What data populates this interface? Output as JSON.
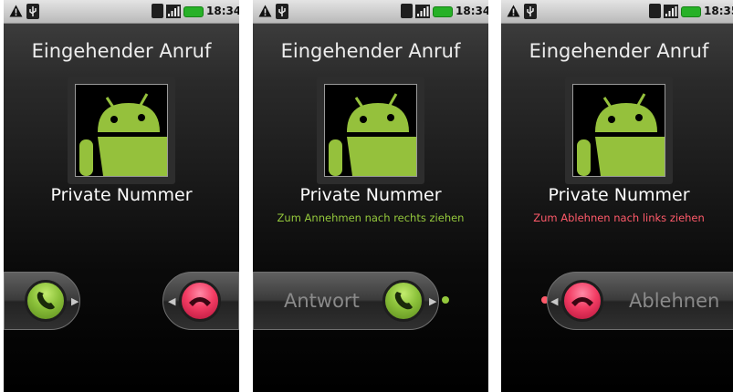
{
  "colors": {
    "status_bar": "#c9c9c9",
    "accept_green": "#94c83c",
    "decline_red": "#ff5a6a",
    "battery_green": "#27b127"
  },
  "icons": {
    "status": [
      "warning-icon",
      "usb-icon",
      "3g-icon",
      "signal-icon",
      "battery-icon"
    ],
    "contact": "android-robot-icon",
    "accept": "phone-handset-icon",
    "decline": "phone-hangup-icon"
  },
  "screens": [
    {
      "status_bar": {
        "time": "18:34"
      },
      "title": "Eingehender Anruf",
      "caller": "Private Nummer",
      "hint": "",
      "answer_label": "",
      "decline_label": ""
    },
    {
      "status_bar": {
        "time": "18:34"
      },
      "title": "Eingehender Anruf",
      "caller": "Private Nummer",
      "hint": "Zum Annehmen nach rechts ziehen",
      "answer_label": "Antwort",
      "decline_label": ""
    },
    {
      "status_bar": {
        "time": "18:35"
      },
      "title": "Eingehender Anruf",
      "caller": "Private Nummer",
      "hint": "Zum Ablehnen nach links ziehen",
      "answer_label": "",
      "decline_label": "Ablehnen"
    }
  ]
}
